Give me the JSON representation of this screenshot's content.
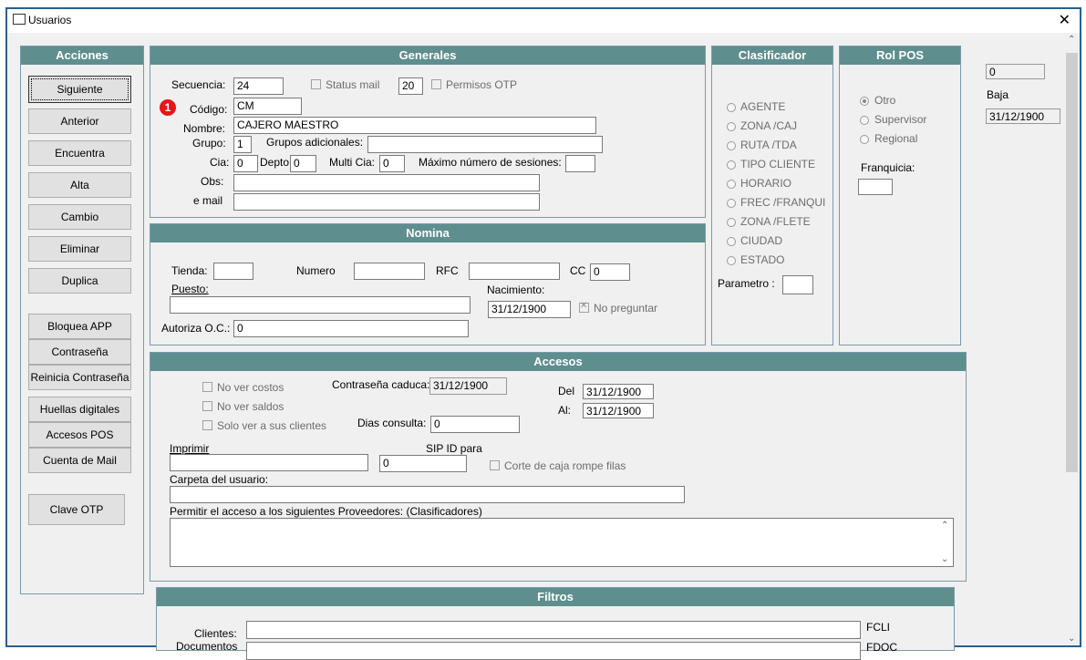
{
  "window": {
    "title": "Usuarios",
    "close": "✕"
  },
  "acciones": {
    "header": "Acciones",
    "buttons": [
      "Siguiente",
      "Anterior",
      "Encuentra",
      "Alta",
      "Cambio",
      "Eliminar",
      "Duplica"
    ],
    "group2": [
      "Bloquea APP",
      "Contraseña",
      "Reinicia Contraseña"
    ],
    "group3": [
      "Huellas digitales",
      "Accesos POS",
      "Cuenta de Mail"
    ],
    "clave_otp": "Clave OTP"
  },
  "generales": {
    "header": "Generales",
    "secuencia_label": "Secuencia:",
    "secuencia": "24",
    "status_mail": "Status mail",
    "status_num": "20",
    "permisos_otp": "Permisos OTP",
    "badge": "1",
    "codigo_label": "Código:",
    "codigo": "CM",
    "nombre_label": "Nombre:",
    "nombre": "CAJERO MAESTRO",
    "grupo_label": "Grupo:",
    "grupo": "1",
    "grupos_adicionales_label": "Grupos adicionales:",
    "grupos_adicionales": "",
    "cia_label": "Cia:",
    "cia": "0",
    "depto_label": "Depto",
    "depto": "0",
    "multi_cia_label": "Multi Cia:",
    "multi_cia": "0",
    "max_sesiones_label": "Máximo número de sesiones:",
    "max_sesiones": "",
    "obs_label": "Obs:",
    "obs": "",
    "email_label": "e mail",
    "email": ""
  },
  "clasificador": {
    "header": "Clasificador",
    "options": [
      "AGENTE",
      "ZONA /CAJ",
      "RUTA /TDA",
      "TIPO CLIENTE",
      "HORARIO",
      "FREC /FRANQUI",
      "ZONA /FLETE",
      "CIUDAD",
      "ESTADO"
    ],
    "parametro_label": "Parametro :",
    "parametro": ""
  },
  "rol_pos": {
    "header": "Rol POS",
    "options": [
      "Otro",
      "Supervisor",
      "Regional"
    ],
    "franquicia_label": "Franquicia:",
    "franquicia": ""
  },
  "side": {
    "value": "0",
    "baja_label": "Baja",
    "baja": "31/12/1900"
  },
  "nomina": {
    "header": "Nomina",
    "tienda_label": "Tienda:",
    "tienda": "",
    "numero_label": "Numero",
    "numero": "",
    "rfc_label": "RFC",
    "rfc": "",
    "cc_label": "CC",
    "cc": "0",
    "puesto_label": "Puesto:",
    "puesto": "",
    "nacimiento_label": "Nacimiento:",
    "nacimiento": "31/12/1900",
    "no_preguntar": "No preguntar",
    "autoriza_label": "Autoriza O.C.:",
    "autoriza": "0"
  },
  "accesos": {
    "header": "Accesos",
    "no_ver_costos": "No ver costos",
    "no_ver_saldos": "No ver saldos",
    "solo_clientes": "Solo ver a sus clientes",
    "contrasena_caduca_label": "Contraseña caduca:",
    "contrasena_caduca": "31/12/1900",
    "del_label": "Del",
    "del": "31/12/1900",
    "al_label": "Al:",
    "al": "31/12/1900",
    "dias_consulta_label": "Dias consulta:",
    "dias_consulta": "0",
    "imprimir_label": "Imprimir",
    "imprimir": "",
    "sip_label": "SIP ID para",
    "sip": "0",
    "corte_caja": "Corte de caja rompe filas",
    "carpeta_label": "Carpeta del usuario:",
    "carpeta": "",
    "permitir_label": "Permitir el acceso a los siguientes Proveedores: (Clasificadores)",
    "permitir": ""
  },
  "filtros": {
    "header": "Filtros",
    "clientes_label": "Clientes:",
    "clientes": "",
    "fcli": "FCLI",
    "documentos_label": "Documentos",
    "fdoc": "FDOC"
  }
}
